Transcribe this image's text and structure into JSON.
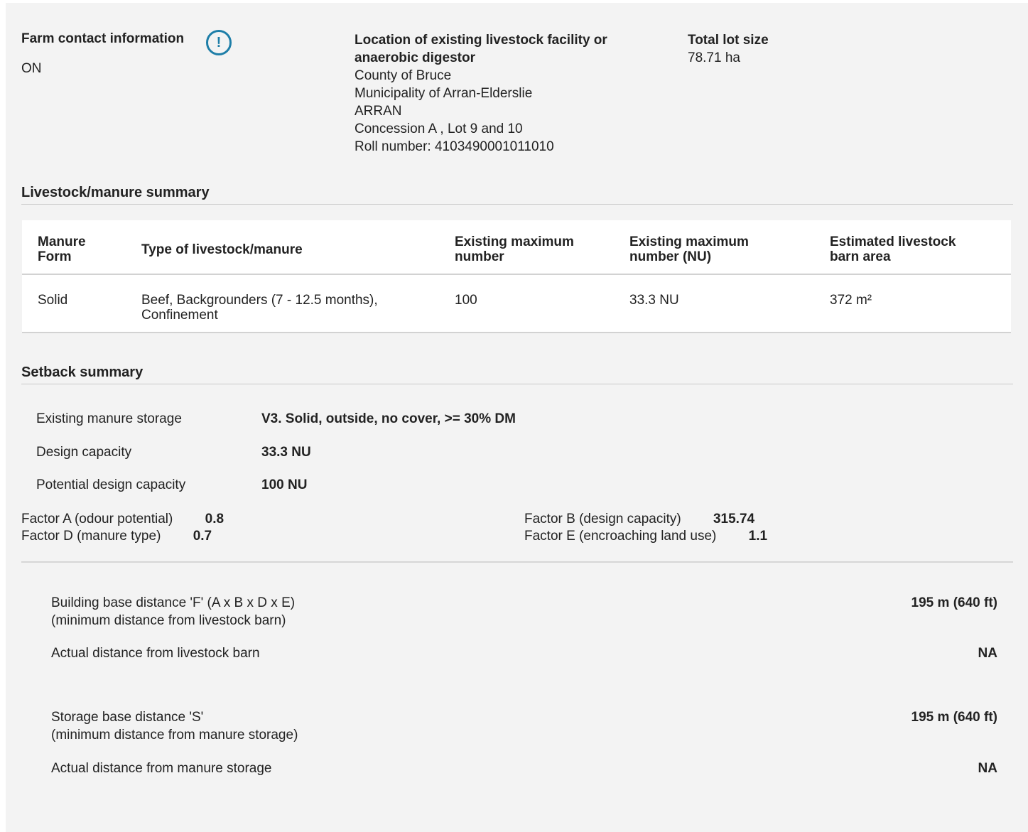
{
  "header": {
    "contact_title": "Farm contact information",
    "info_icon": "exclamation-circle-icon",
    "contact_province": "ON",
    "location_title_line1": "Location of existing livestock facility or",
    "location_title_line2": "anaerobic digestor",
    "location_lines": [
      "County of Bruce",
      "Municipality of Arran-Elderslie",
      "ARRAN",
      "Concession A , Lot 9 and 10",
      "Roll number: 4103490001011010"
    ],
    "lot_title": "Total lot size",
    "lot_value": "78.71 ha"
  },
  "livestock": {
    "title": "Livestock/manure summary",
    "headers": {
      "form_l1": "Manure",
      "form_l2": "Form",
      "type": "Type of livestock/manure",
      "max_l1": "Existing maximum",
      "max_l2": "number",
      "nu_l1": "Existing maximum",
      "nu_l2": "number (NU)",
      "area_l1": "Estimated livestock",
      "area_l2": "barn area"
    },
    "rows": [
      {
        "form": "Solid",
        "type_l1": "Beef, Backgrounders (7 - 12.5 months),",
        "type_l2": "Confinement",
        "max": "100",
        "nu": "33.3 NU",
        "area": "372 m²"
      }
    ]
  },
  "setback": {
    "title": "Setback summary",
    "storage_label": "Existing manure storage",
    "storage_value": "V3. Solid, outside, no cover, >= 30% DM",
    "design_label": "Design capacity",
    "design_value": "33.3 NU",
    "potential_label": "Potential design capacity",
    "potential_value": "100 NU",
    "factor_a_label": "Factor A (odour potential)",
    "factor_a_value": "0.8",
    "factor_d_label": "Factor D (manure type)",
    "factor_d_value": "0.7",
    "factor_b_label": "Factor B (design capacity)",
    "factor_b_value": "315.74",
    "factor_e_label": "Factor E (encroaching land use)",
    "factor_e_value": "1.1",
    "building_label_l1": "Building base distance 'F' (A x B x D x E)",
    "building_label_l2": "(minimum distance from livestock barn)",
    "building_value": "195 m (640 ft)",
    "actual_barn_label": "Actual distance from livestock barn",
    "actual_barn_value": "NA",
    "storage_dist_label_l1": "Storage base distance 'S'",
    "storage_dist_label_l2": "(minimum distance from manure storage)",
    "storage_dist_value": "195 m (640 ft)",
    "actual_storage_label": "Actual distance from manure storage",
    "actual_storage_value": "NA"
  }
}
